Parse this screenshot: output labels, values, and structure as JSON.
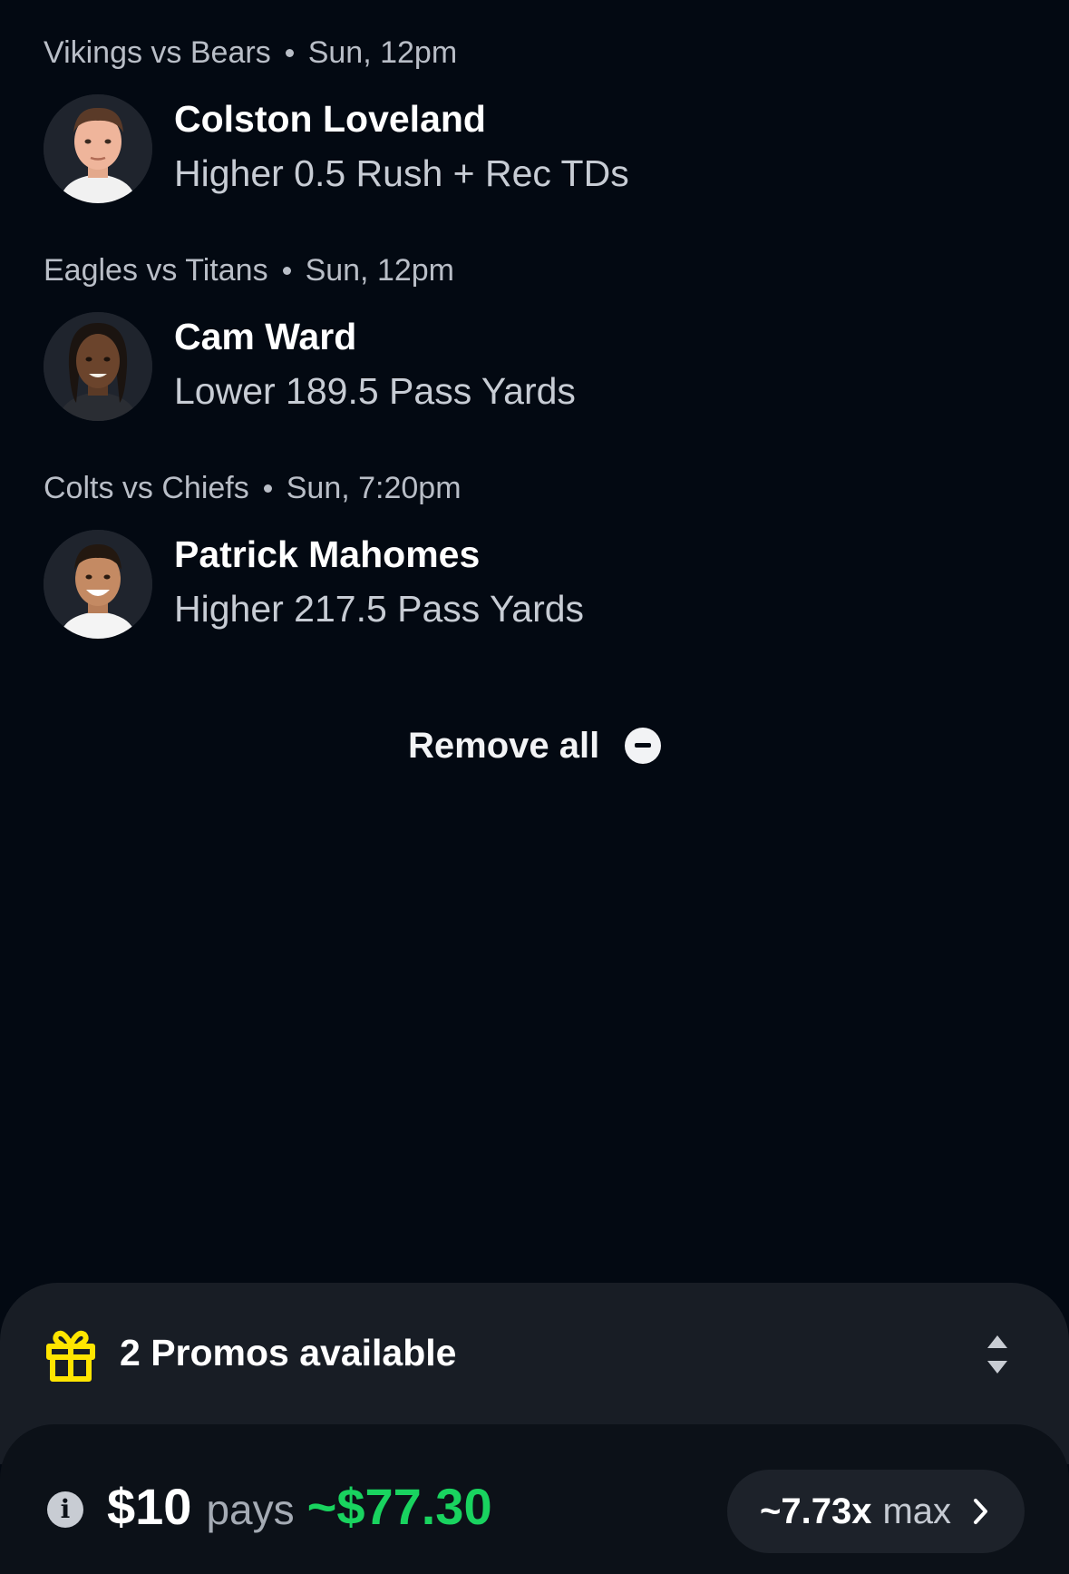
{
  "picks": [
    {
      "matchup": "Vikings vs Bears",
      "time": "Sun, 12pm",
      "player": "Colston Loveland",
      "line": "Higher 0.5 Rush + Rec TDs"
    },
    {
      "matchup": "Eagles vs Titans",
      "time": "Sun, 12pm",
      "player": "Cam Ward",
      "line": "Lower 189.5 Pass Yards"
    },
    {
      "matchup": "Colts vs Chiefs",
      "time": "Sun, 7:20pm",
      "player": "Patrick Mahomes",
      "line": "Higher 217.5 Pass Yards"
    }
  ],
  "remove_all_label": "Remove all",
  "promos": {
    "label": "2 Promos available",
    "icon": "gift-icon",
    "accent": "#ffe500"
  },
  "payout": {
    "stake": "$10",
    "pays_word": "pays",
    "amount": "~$77.30",
    "amount_color": "#19d35f",
    "multiplier": "~7.73x",
    "multiplier_suffix": "max"
  }
}
